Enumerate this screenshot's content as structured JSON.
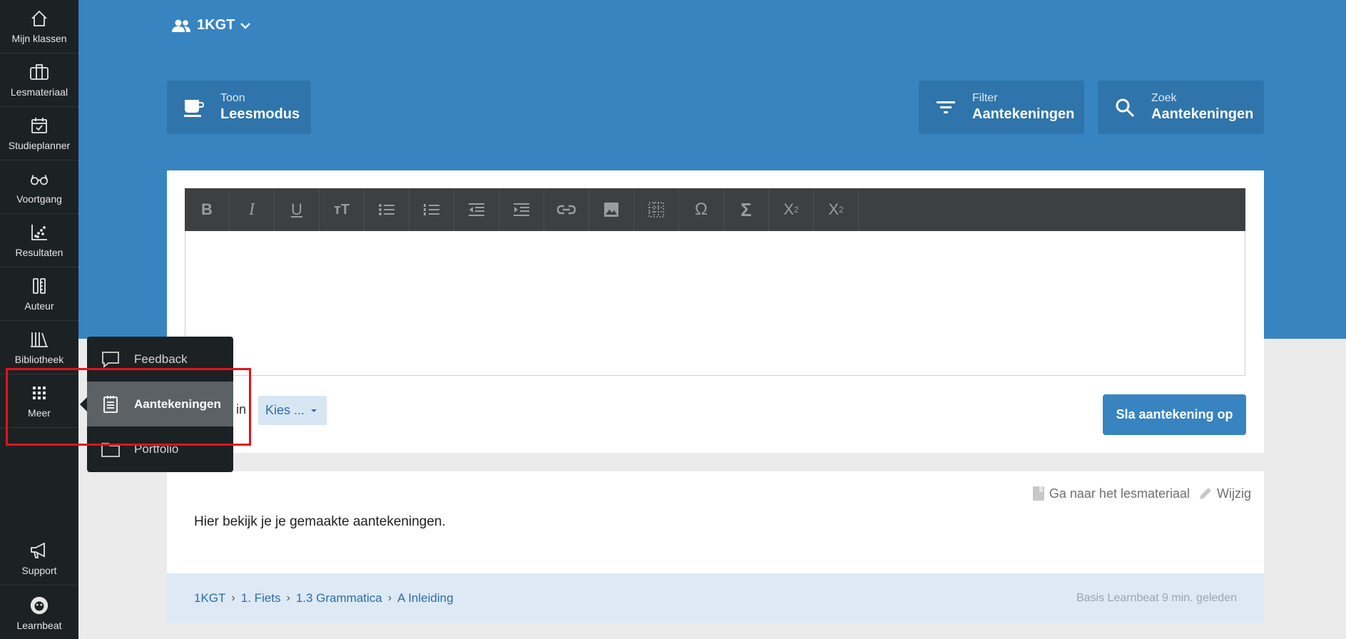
{
  "sidebar": {
    "items": [
      {
        "label": "Mijn klassen",
        "icon": "home-icon"
      },
      {
        "label": "Lesmateriaal",
        "icon": "briefcase-icon"
      },
      {
        "label": "Studieplanner",
        "icon": "calendar-check-icon"
      },
      {
        "label": "Voortgang",
        "icon": "glasses-icon"
      },
      {
        "label": "Resultaten",
        "icon": "scatter-chart-icon"
      },
      {
        "label": "Auteur",
        "icon": "pen-ruler-icon"
      },
      {
        "label": "Bibliotheek",
        "icon": "books-icon"
      },
      {
        "label": "Meer",
        "icon": "grid-icon"
      }
    ],
    "support_label": "Support",
    "learnbeat_label": "Learnbeat"
  },
  "header": {
    "class_name": "1KGT",
    "buttons": {
      "read_small": "Toon",
      "read_big": "Leesmodus",
      "filter_small": "Filter",
      "filter_big": "Aantekeningen",
      "search_small": "Zoek",
      "search_big": "Aantekeningen"
    }
  },
  "editor": {
    "toolbar": [
      "bold-icon",
      "italic-icon",
      "underline-icon",
      "text-size-icon",
      "bullet-list-icon",
      "numbered-list-icon",
      "outdent-icon",
      "indent-icon",
      "link-icon",
      "image-icon",
      "table-icon",
      "omega-icon",
      "sigma-icon",
      "subscript-icon",
      "superscript-icon"
    ],
    "in_label": "in",
    "select_label": "Kies ...",
    "save_label": "Sla aantekening op"
  },
  "note": {
    "goto_label": "Ga naar het lesmateriaal",
    "edit_label": "Wijzig",
    "text": "Hier bekijk je je gemaakte aantekeningen.",
    "breadcrumb": [
      "1KGT",
      "1. Fiets",
      "1.3 Grammatica",
      "A Inleiding"
    ],
    "meta": "Basis Learnbeat 9 min. geleden"
  },
  "popover": {
    "items": [
      {
        "label": "Feedback",
        "icon": "speech-bubble-icon"
      },
      {
        "label": "Aantekeningen",
        "icon": "notepad-icon"
      },
      {
        "label": "Portfolio",
        "icon": "folder-icon"
      }
    ]
  },
  "colors": {
    "sidebar": "#1c2124",
    "primary": "#3784c1",
    "highlight": "#e5121a"
  }
}
